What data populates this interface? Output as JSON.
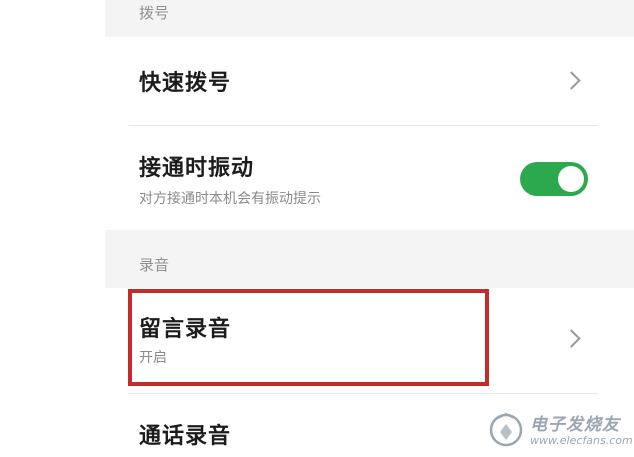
{
  "colors": {
    "accent": "#2ca94f",
    "highlight": "#c62b2b"
  },
  "sections": {
    "dial": {
      "header": "拨号"
    },
    "recording": {
      "header": "录音"
    }
  },
  "rows": {
    "speed_dial": {
      "title": "快速拨号",
      "icon": "chevron-right-icon"
    },
    "vibrate_on_connect": {
      "title": "接通时振动",
      "subtitle": "对方接通时本机会有振动提示",
      "toggle_on": true
    },
    "voicemail_recording": {
      "title": "留言录音",
      "subtitle": "开启",
      "icon": "chevron-right-icon"
    },
    "call_recording": {
      "title": "通话录音"
    }
  },
  "watermark": {
    "title": "电子发烧友",
    "url": "www.elecfans.com",
    "icon": "elecfans-logo-icon"
  }
}
